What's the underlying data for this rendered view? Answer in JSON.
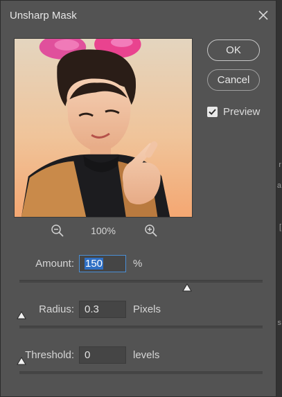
{
  "dialog": {
    "title": "Unsharp Mask",
    "ok_label": "OK",
    "cancel_label": "Cancel",
    "preview": {
      "label": "Preview",
      "checked": true
    }
  },
  "zoom": {
    "level": "100%"
  },
  "params": {
    "amount": {
      "label": "Amount:",
      "value": "150",
      "unit": "%",
      "slider_fraction": 0.68
    },
    "radius": {
      "label": "Radius:",
      "value": "0.3",
      "unit": "Pixels",
      "slider_fraction": 0.0
    },
    "threshold": {
      "label": "Threshold:",
      "value": "0",
      "unit": "levels",
      "slider_fraction": 0.0
    }
  },
  "icons": {
    "close": "close-icon",
    "zoom_out": "zoom-out-icon",
    "zoom_in": "zoom-in-icon",
    "check": "checkmark-icon",
    "slider_thumb": "triangle-thumb-icon"
  },
  "colors": {
    "dialog_bg": "#535353",
    "selection": "#2f6fc4",
    "focus_border": "#4a8fd6"
  }
}
